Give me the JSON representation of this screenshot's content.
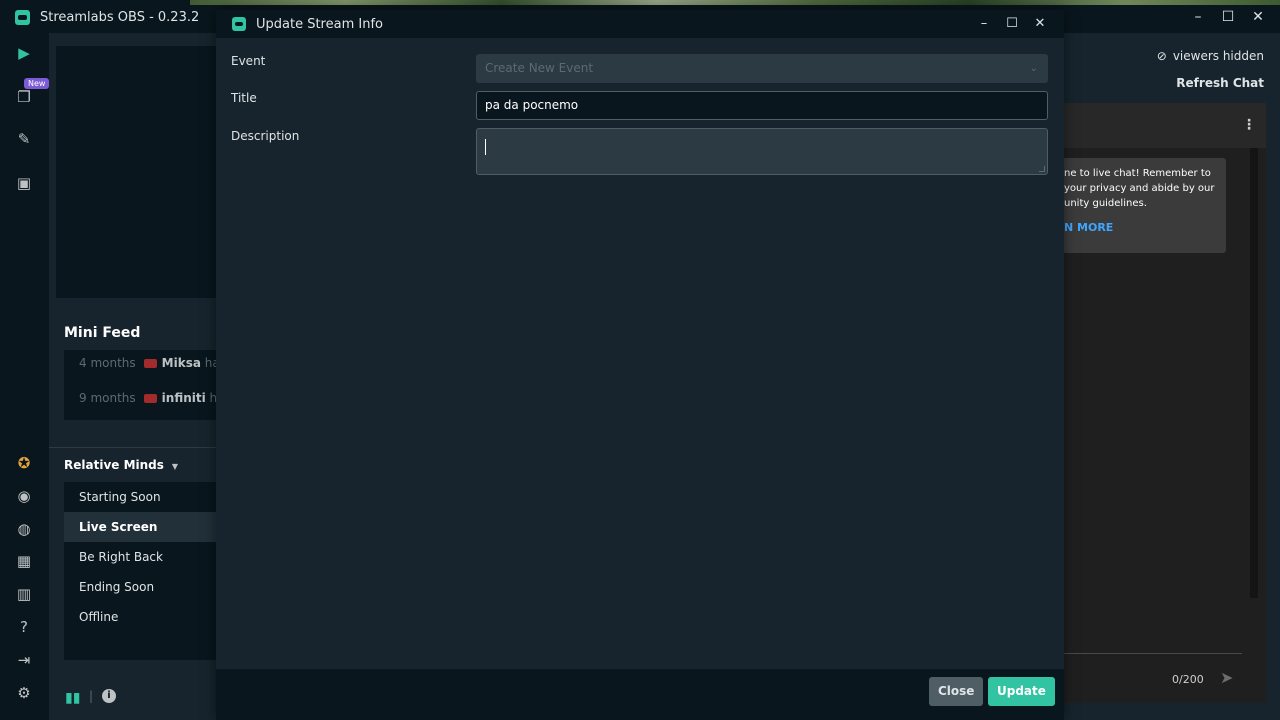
{
  "app": {
    "title": "Streamlabs OBS - 0.23.2",
    "window_controls": [
      "–",
      "☐",
      "✕"
    ]
  },
  "left_nav": {
    "new_badge": "New",
    "icons": [
      "studio-mode-icon",
      "layout-editor-icon",
      "themes-icon",
      "store-icon",
      "highlighter-icon",
      "dashboard-icon",
      "chat-icon",
      "apps-icon",
      "library-icon",
      "help-icon",
      "logout-icon",
      "settings-icon"
    ]
  },
  "mini_feed": {
    "title": "Mini Feed",
    "items": [
      {
        "time": "4 months",
        "name": "Miksa",
        "rest": "ha"
      },
      {
        "time": "9 months",
        "name": "infiniti",
        "rest": "h"
      }
    ]
  },
  "scene_collection": {
    "name": "Relative Minds",
    "scenes": [
      "Starting Soon",
      "Live Screen",
      "Be Right Back",
      "Ending Soon",
      "Offline"
    ],
    "active": "Live Screen"
  },
  "chat": {
    "viewers_hidden": "viewers hidden",
    "refresh": "Refresh Chat",
    "welcome": "ne to live chat! Remember to\nyour privacy and abide by our\nunity guidelines.",
    "learn_more": "N MORE",
    "char_count": "0/200"
  },
  "modal": {
    "title": "Update Stream Info",
    "event_label": "Event",
    "event_value": "Create New Event",
    "title_label": "Title",
    "title_value": "pa da pocnemo",
    "description_label": "Description",
    "description_value": "",
    "close_label": "Close",
    "update_label": "Update"
  },
  "colors": {
    "accent": "#31c3a2",
    "background": "#17242d",
    "dark": "#09161d"
  }
}
